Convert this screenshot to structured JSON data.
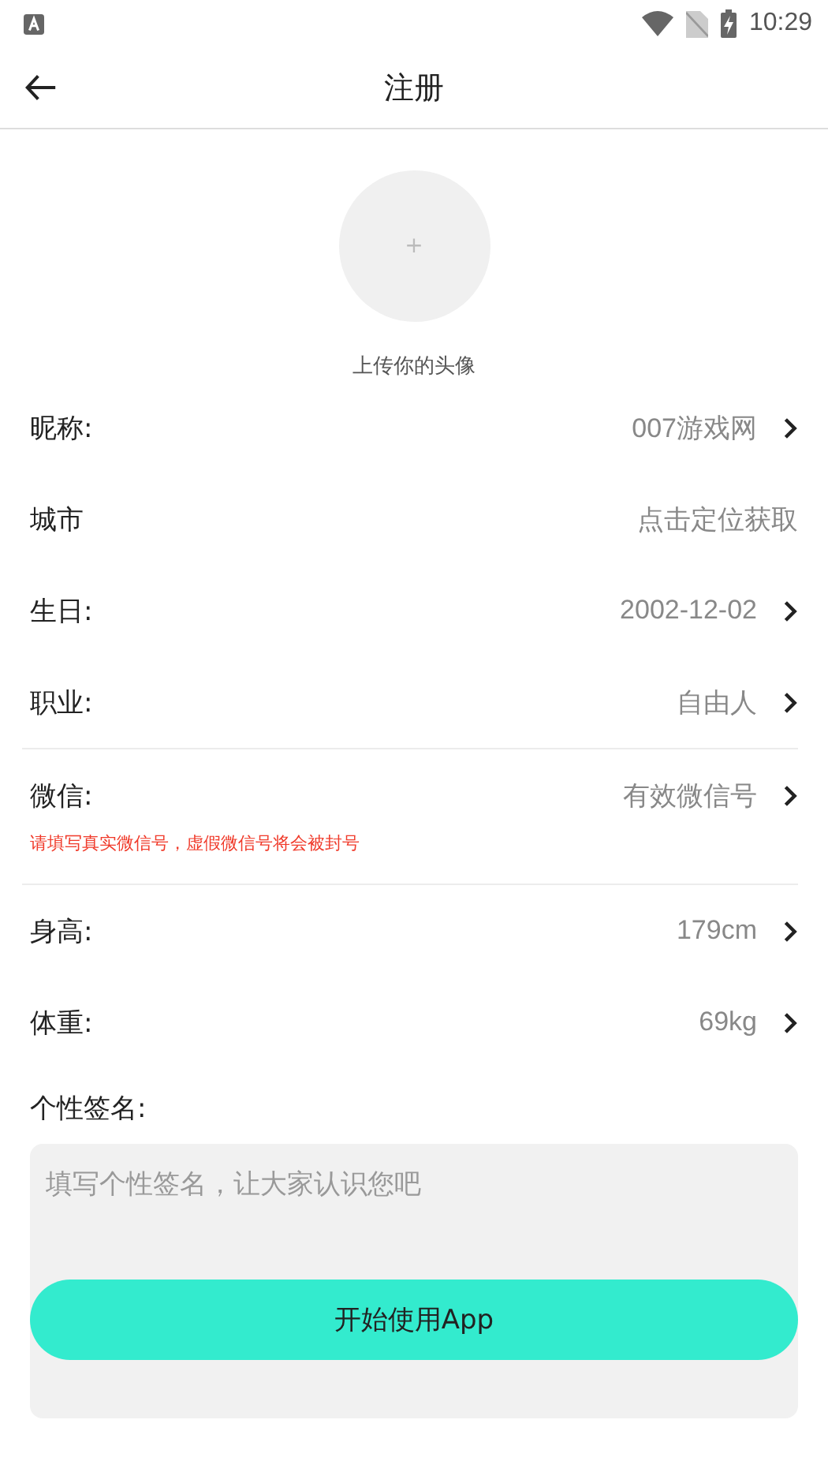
{
  "status_bar": {
    "time": "10:29"
  },
  "header": {
    "title": "注册"
  },
  "avatar": {
    "caption": "上传你的头像",
    "plus": "+"
  },
  "sections": [
    {
      "rows": [
        {
          "label": "昵称:",
          "value": "007游戏网",
          "chevron": true
        },
        {
          "label": "城市",
          "value": "点击定位获取",
          "chevron": false
        },
        {
          "label": "生日:",
          "value": "2002-12-02",
          "chevron": true
        },
        {
          "label": "职业:",
          "value": "自由人",
          "chevron": true
        }
      ]
    },
    {
      "rows": [
        {
          "label": "微信:",
          "value": "有效微信号",
          "chevron": true
        }
      ],
      "note": "请填写真实微信号，虚假微信号将会被封号"
    },
    {
      "rows": [
        {
          "label": "身高:",
          "value": "179cm",
          "chevron": true
        },
        {
          "label": "体重:",
          "value": "69kg",
          "chevron": true
        }
      ]
    }
  ],
  "signature": {
    "label": "个性签名:",
    "placeholder": "填写个性签名，让大家认识您吧"
  },
  "submit": "开始使用App"
}
